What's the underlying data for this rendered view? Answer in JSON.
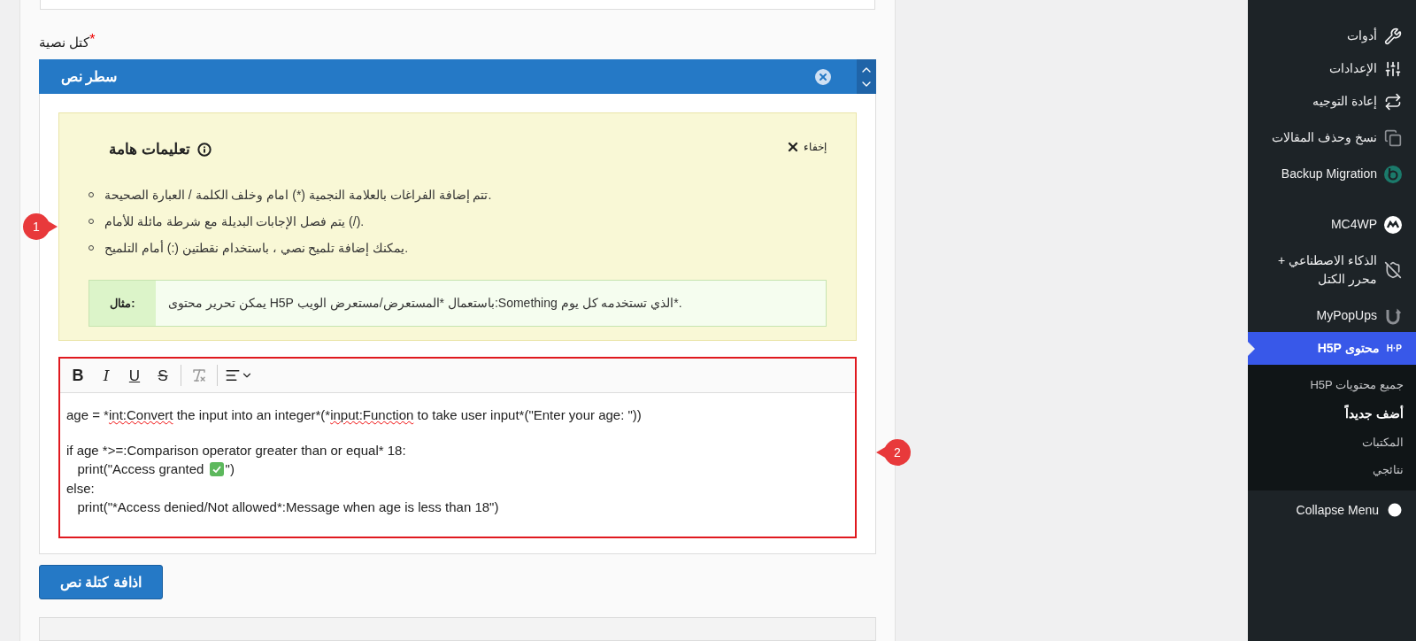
{
  "field": {
    "label": "كتل نصية",
    "required": true,
    "required_mark": "*"
  },
  "block": {
    "title": "سطر نص"
  },
  "notice": {
    "title": "تعليمات هامة",
    "hide": "إخفاء",
    "items": [
      "تتم إضافة الفراغات بالعلامة النجمية (*) امام وخلف الكلمة / العبارة الصحيحة.",
      "يتم فصل الإجابات البديلة مع شرطة مائلة للأمام (/).",
      "يمكنك إضافة تلميح نصي ، باستخدام نقطتين (:) أمام التلميح."
    ],
    "example": {
      "label": "مثال:",
      "text": ".*الذي تستخدمه كل يوم Something:باستعمال *المستعرض/مستعرض الويب H5P يمكن تحرير محتوى"
    }
  },
  "editor": {
    "toolbar": {
      "bold": "B",
      "italic": "I",
      "underline": "U",
      "strike": "S"
    },
    "first_line": {
      "start": {
        "text": "age = *",
        "misspelled": false
      },
      "word_a": {
        "text": "int:Convert",
        "misspelled": true
      },
      "middle": {
        "text": " the input into an integer*(*",
        "misspelled": false
      },
      "word_b": {
        "text": "input:Function",
        "misspelled": true
      },
      "end": {
        "text": " to take user input*(\"Enter your age: \"))",
        "misspelled": false
      }
    },
    "block": {
      "condition": "if age *>=:Comparison operator greater than or equal* 18:",
      "granted": {
        "before": "   print(\"Access granted ",
        "after": "\")"
      },
      "else": "else:",
      "denied": "   print(\"*Access denied/Not allowed*:Message when age is less than 18\")"
    }
  },
  "add_button": "اذافة كتلة نص",
  "callouts": [
    {
      "label": "1"
    },
    {
      "label": "2"
    }
  ],
  "sidebar": {
    "items": [
      {
        "kind": "wrench",
        "label": "أدوات",
        "selected": false
      },
      {
        "kind": "sliders",
        "label": "الإعدادات",
        "selected": false
      },
      {
        "kind": "repeat",
        "label": "إعادة التوجيه",
        "selected": false
      },
      {
        "kind": "copy",
        "label": "نسخ وحذف المقالات",
        "selected": false
      },
      {
        "kind": "backup",
        "label": "Backup Migration",
        "selected": false
      },
      {
        "kind": "mc4wp",
        "label": "MC4WP",
        "selected": false
      },
      {
        "kind": "shield",
        "label": "الذكاء الاصطناعي + محرر الكتل",
        "selected": false
      },
      {
        "kind": "popup",
        "label": "MyPopUps",
        "selected": false
      },
      {
        "kind": "h5p",
        "icon_text": "H·P",
        "label": "محتوى H5P",
        "selected": true
      }
    ],
    "submenu": [
      {
        "label": "جميع محتويات H5P",
        "selected": false
      },
      {
        "label": "أضف جديداً",
        "selected": true
      },
      {
        "label": "المكتبات",
        "selected": false
      },
      {
        "label": "نتائجي",
        "selected": false
      }
    ],
    "collapse": "Collapse Menu"
  }
}
